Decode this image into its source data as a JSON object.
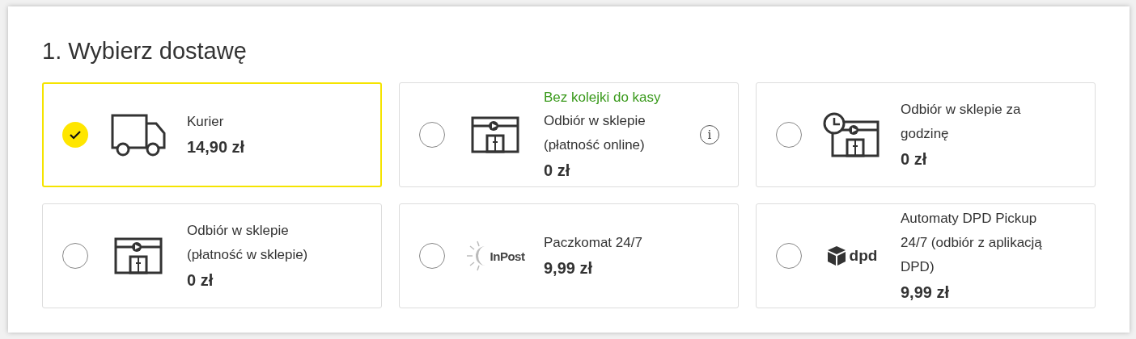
{
  "title": "1. Wybierz dostawę",
  "options": [
    {
      "kind": "truck",
      "label": "Kurier",
      "price": "14,90 zł",
      "selected": true
    },
    {
      "kind": "store",
      "promo": "Bez kolejki do kasy",
      "label": "Odbiór w sklepie (płatność online)",
      "price": "0 zł",
      "info": "i",
      "selected": false
    },
    {
      "kind": "store-clock",
      "label": "Odbiór w sklepie za godzinę",
      "price": "0 zł",
      "selected": false
    },
    {
      "kind": "store",
      "label": "Odbiór w sklepie (płatność w sklepie)",
      "price": "0 zł",
      "selected": false
    },
    {
      "kind": "inpost",
      "logo_text": "InPost",
      "label": "Paczkomat 24/7",
      "price": "9,99 zł",
      "selected": false
    },
    {
      "kind": "dpd",
      "logo_text": "dpd",
      "label": "Automaty DPD Pickup 24/7 (odbiór z aplikacją DPD)",
      "price": "9,99 zł",
      "selected": false
    }
  ]
}
